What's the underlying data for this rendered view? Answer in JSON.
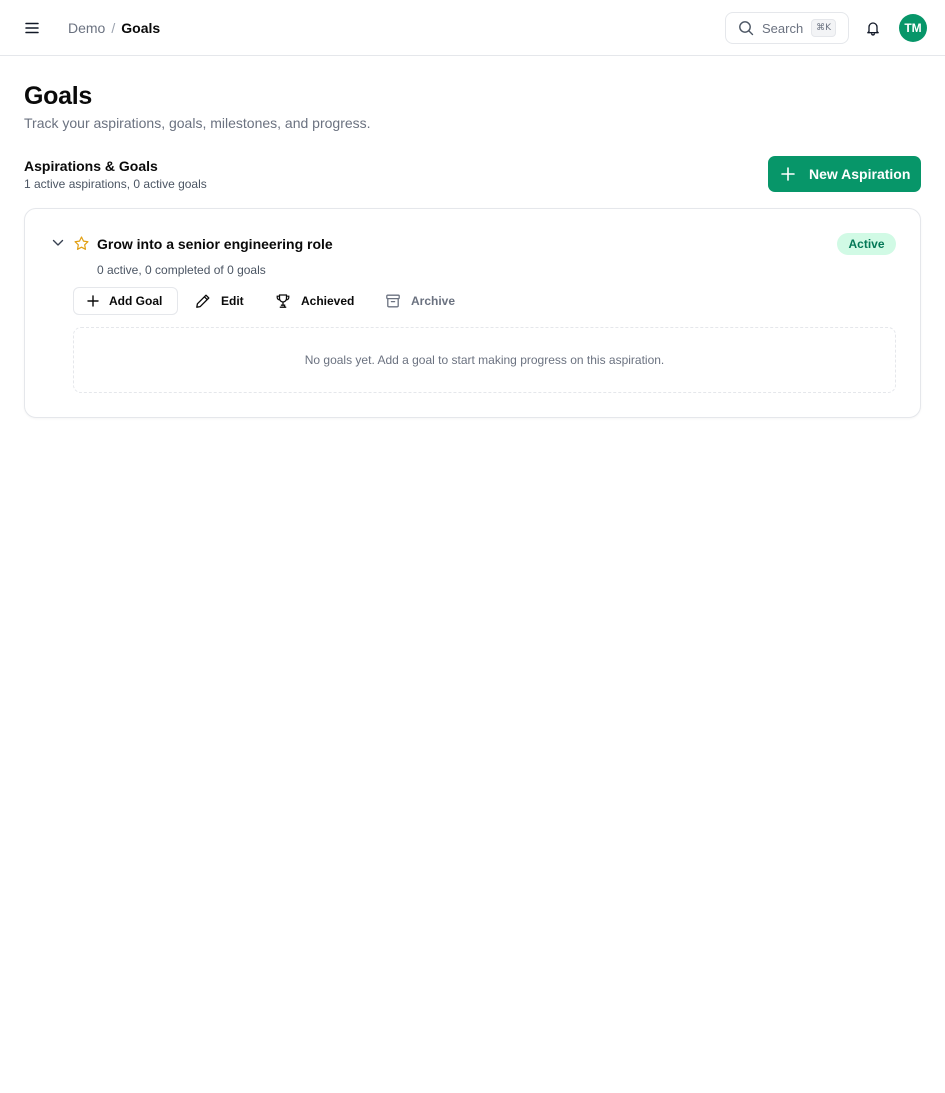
{
  "header": {
    "breadcrumb": {
      "parent": "Demo",
      "separator": "/",
      "current": "Goals"
    },
    "search": {
      "label": "Search",
      "shortcut": "⌘K",
      "icon": "search-icon"
    },
    "notifications_icon": "bell-icon",
    "avatar_initials": "TM",
    "avatar_color": "#079669"
  },
  "page": {
    "title": "Goals",
    "subtitle": "Track your aspirations, goals, milestones, and progress."
  },
  "section": {
    "title": "Aspirations & Goals",
    "summary": "1 active aspirations, 0 active goals",
    "new_button_label": "New Aspiration",
    "accent_color": "#079669"
  },
  "aspirations": [
    {
      "title": "Grow into a senior engineering role",
      "status": "Active",
      "summary": "0 active, 0 completed of 0 goals",
      "actions": {
        "add_goal": "Add Goal",
        "edit": "Edit",
        "achieved": "Achieved",
        "archive": "Archive"
      },
      "empty_message": "No goals yet. Add a goal to start making progress on this aspiration."
    }
  ]
}
